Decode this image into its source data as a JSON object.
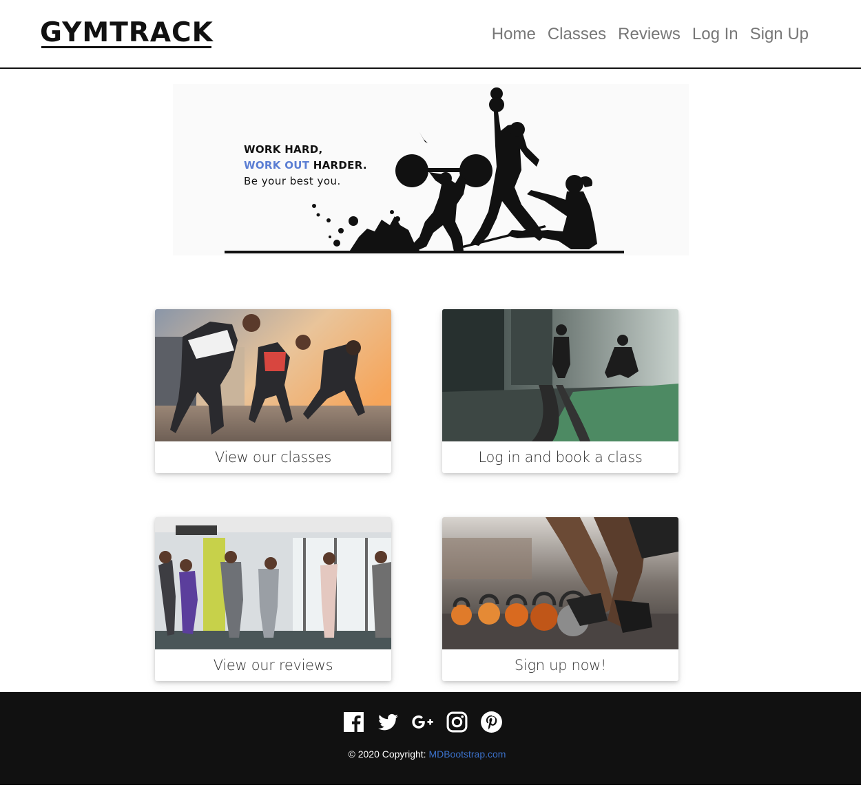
{
  "header": {
    "brand": "GYMTRACK",
    "nav": [
      "Home",
      "Classes",
      "Reviews",
      "Log In",
      "Sign Up"
    ]
  },
  "banner": {
    "line1": "WORK HARD,",
    "line2_accent": "WORK OUT",
    "line2_rest": " HARDER.",
    "line3": "Be your best you.",
    "accent_color": "#5b7ed3"
  },
  "cards": [
    {
      "label": "View our classes"
    },
    {
      "label": "Log in and book a class"
    },
    {
      "label": "View our reviews"
    },
    {
      "label": "Sign up now!"
    }
  ],
  "footer": {
    "social_icons": [
      "facebook-icon",
      "twitter-icon",
      "google-plus-icon",
      "instagram-icon",
      "pinterest-icon"
    ],
    "copyright_prefix": "© 2020 Copyright: ",
    "copyright_link": "MDBootstrap.com",
    "link_color": "#3b71ca",
    "background": "#111111"
  }
}
